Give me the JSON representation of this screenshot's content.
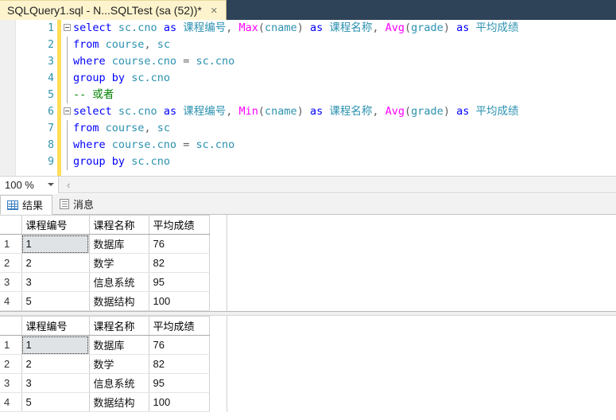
{
  "window": {
    "tab": {
      "title": "SQLQuery1.sql - N...SQLTest (sa (52))*",
      "close_label": "×"
    }
  },
  "editor": {
    "lines": [
      {
        "number": "1",
        "fold": true,
        "tokens": [
          {
            "t": "select",
            "c": "k"
          },
          {
            "t": " ",
            "c": "pn"
          },
          {
            "t": "sc.cno",
            "c": "id"
          },
          {
            "t": " ",
            "c": "pn"
          },
          {
            "t": "as",
            "c": "k"
          },
          {
            "t": " ",
            "c": "pn"
          },
          {
            "t": "课程编号",
            "c": "cn"
          },
          {
            "t": ", ",
            "c": "pn"
          },
          {
            "t": "Max",
            "c": "fn"
          },
          {
            "t": "(",
            "c": "pn"
          },
          {
            "t": "cname",
            "c": "id"
          },
          {
            "t": ")",
            "c": "pn"
          },
          {
            "t": " ",
            "c": "pn"
          },
          {
            "t": "as",
            "c": "k"
          },
          {
            "t": " ",
            "c": "pn"
          },
          {
            "t": "课程名称",
            "c": "cn"
          },
          {
            "t": ", ",
            "c": "pn"
          },
          {
            "t": "Avg",
            "c": "fn"
          },
          {
            "t": "(",
            "c": "pn"
          },
          {
            "t": "grade",
            "c": "id"
          },
          {
            "t": ")",
            "c": "pn"
          },
          {
            "t": " ",
            "c": "pn"
          },
          {
            "t": "as",
            "c": "k"
          },
          {
            "t": " ",
            "c": "pn"
          },
          {
            "t": "平均成绩",
            "c": "cn"
          }
        ]
      },
      {
        "number": "2",
        "fold": false,
        "tokens": [
          {
            "t": "from",
            "c": "k"
          },
          {
            "t": " ",
            "c": "pn"
          },
          {
            "t": "course",
            "c": "id"
          },
          {
            "t": ", ",
            "c": "pn"
          },
          {
            "t": "sc",
            "c": "id"
          }
        ]
      },
      {
        "number": "3",
        "fold": false,
        "tokens": [
          {
            "t": "where",
            "c": "k"
          },
          {
            "t": " ",
            "c": "pn"
          },
          {
            "t": "course.cno",
            "c": "id"
          },
          {
            "t": " = ",
            "c": "op"
          },
          {
            "t": "sc.cno",
            "c": "id"
          }
        ]
      },
      {
        "number": "4",
        "fold": false,
        "tokens": [
          {
            "t": "group",
            "c": "k"
          },
          {
            "t": " ",
            "c": "pn"
          },
          {
            "t": "by",
            "c": "k"
          },
          {
            "t": " ",
            "c": "pn"
          },
          {
            "t": "sc.cno",
            "c": "id"
          }
        ]
      },
      {
        "number": "5",
        "fold": false,
        "tokens": [
          {
            "t": "-- 或者",
            "c": "cm"
          }
        ]
      },
      {
        "number": "6",
        "fold": true,
        "tokens": [
          {
            "t": "select",
            "c": "k"
          },
          {
            "t": " ",
            "c": "pn"
          },
          {
            "t": "sc.cno",
            "c": "id"
          },
          {
            "t": " ",
            "c": "pn"
          },
          {
            "t": "as",
            "c": "k"
          },
          {
            "t": " ",
            "c": "pn"
          },
          {
            "t": "课程编号",
            "c": "cn"
          },
          {
            "t": ", ",
            "c": "pn"
          },
          {
            "t": "Min",
            "c": "fn"
          },
          {
            "t": "(",
            "c": "pn"
          },
          {
            "t": "cname",
            "c": "id"
          },
          {
            "t": ")",
            "c": "pn"
          },
          {
            "t": " ",
            "c": "pn"
          },
          {
            "t": "as",
            "c": "k"
          },
          {
            "t": " ",
            "c": "pn"
          },
          {
            "t": "课程名称",
            "c": "cn"
          },
          {
            "t": ", ",
            "c": "pn"
          },
          {
            "t": "Avg",
            "c": "fn"
          },
          {
            "t": "(",
            "c": "pn"
          },
          {
            "t": "grade",
            "c": "id"
          },
          {
            "t": ")",
            "c": "pn"
          },
          {
            "t": " ",
            "c": "pn"
          },
          {
            "t": "as",
            "c": "k"
          },
          {
            "t": " ",
            "c": "pn"
          },
          {
            "t": "平均成绩",
            "c": "cn"
          }
        ]
      },
      {
        "number": "7",
        "fold": false,
        "tokens": [
          {
            "t": "from",
            "c": "k"
          },
          {
            "t": " ",
            "c": "pn"
          },
          {
            "t": "course",
            "c": "id"
          },
          {
            "t": ", ",
            "c": "pn"
          },
          {
            "t": "sc",
            "c": "id"
          }
        ]
      },
      {
        "number": "8",
        "fold": false,
        "tokens": [
          {
            "t": "where",
            "c": "k"
          },
          {
            "t": " ",
            "c": "pn"
          },
          {
            "t": "course.cno",
            "c": "id"
          },
          {
            "t": " = ",
            "c": "op"
          },
          {
            "t": "sc.cno",
            "c": "id"
          }
        ]
      },
      {
        "number": "9",
        "fold": false,
        "tokens": [
          {
            "t": "group",
            "c": "k"
          },
          {
            "t": " ",
            "c": "pn"
          },
          {
            "t": "by",
            "c": "k"
          },
          {
            "t": " ",
            "c": "pn"
          },
          {
            "t": "sc.cno",
            "c": "id"
          }
        ]
      }
    ]
  },
  "zoombar": {
    "zoom_value": "100 %",
    "splitter_glyph": "‹"
  },
  "result_tabs": [
    {
      "label": "结果",
      "icon": "grid-icon",
      "active": true
    },
    {
      "label": "消息",
      "icon": "message-icon",
      "active": false
    }
  ],
  "grids": [
    {
      "headers": [
        "",
        "课程编号",
        "课程名称",
        "平均成绩"
      ],
      "rows": [
        {
          "num": "1",
          "cells": [
            "1",
            "数据库",
            "76"
          ],
          "selected": true
        },
        {
          "num": "2",
          "cells": [
            "2",
            "数学",
            "82"
          ],
          "selected": false
        },
        {
          "num": "3",
          "cells": [
            "3",
            "信息系统",
            "95"
          ],
          "selected": false
        },
        {
          "num": "4",
          "cells": [
            "5",
            "数据结构",
            "100"
          ],
          "selected": false
        }
      ]
    },
    {
      "headers": [
        "",
        "课程编号",
        "课程名称",
        "平均成绩"
      ],
      "rows": [
        {
          "num": "1",
          "cells": [
            "1",
            "数据库",
            "76"
          ],
          "selected": true
        },
        {
          "num": "2",
          "cells": [
            "2",
            "数学",
            "82"
          ],
          "selected": false
        },
        {
          "num": "3",
          "cells": [
            "3",
            "信息系统",
            "95"
          ],
          "selected": false
        },
        {
          "num": "4",
          "cells": [
            "5",
            "数据结构",
            "100"
          ],
          "selected": false
        }
      ]
    }
  ],
  "colors": {
    "tabbar_bg": "#2e4258",
    "tab_bg": "#fdf4ce",
    "keyword": "#0000ff",
    "identifier": "#2b91af",
    "function": "#ff00ff",
    "comment": "#008000",
    "change_bar": "#ffdd55"
  }
}
